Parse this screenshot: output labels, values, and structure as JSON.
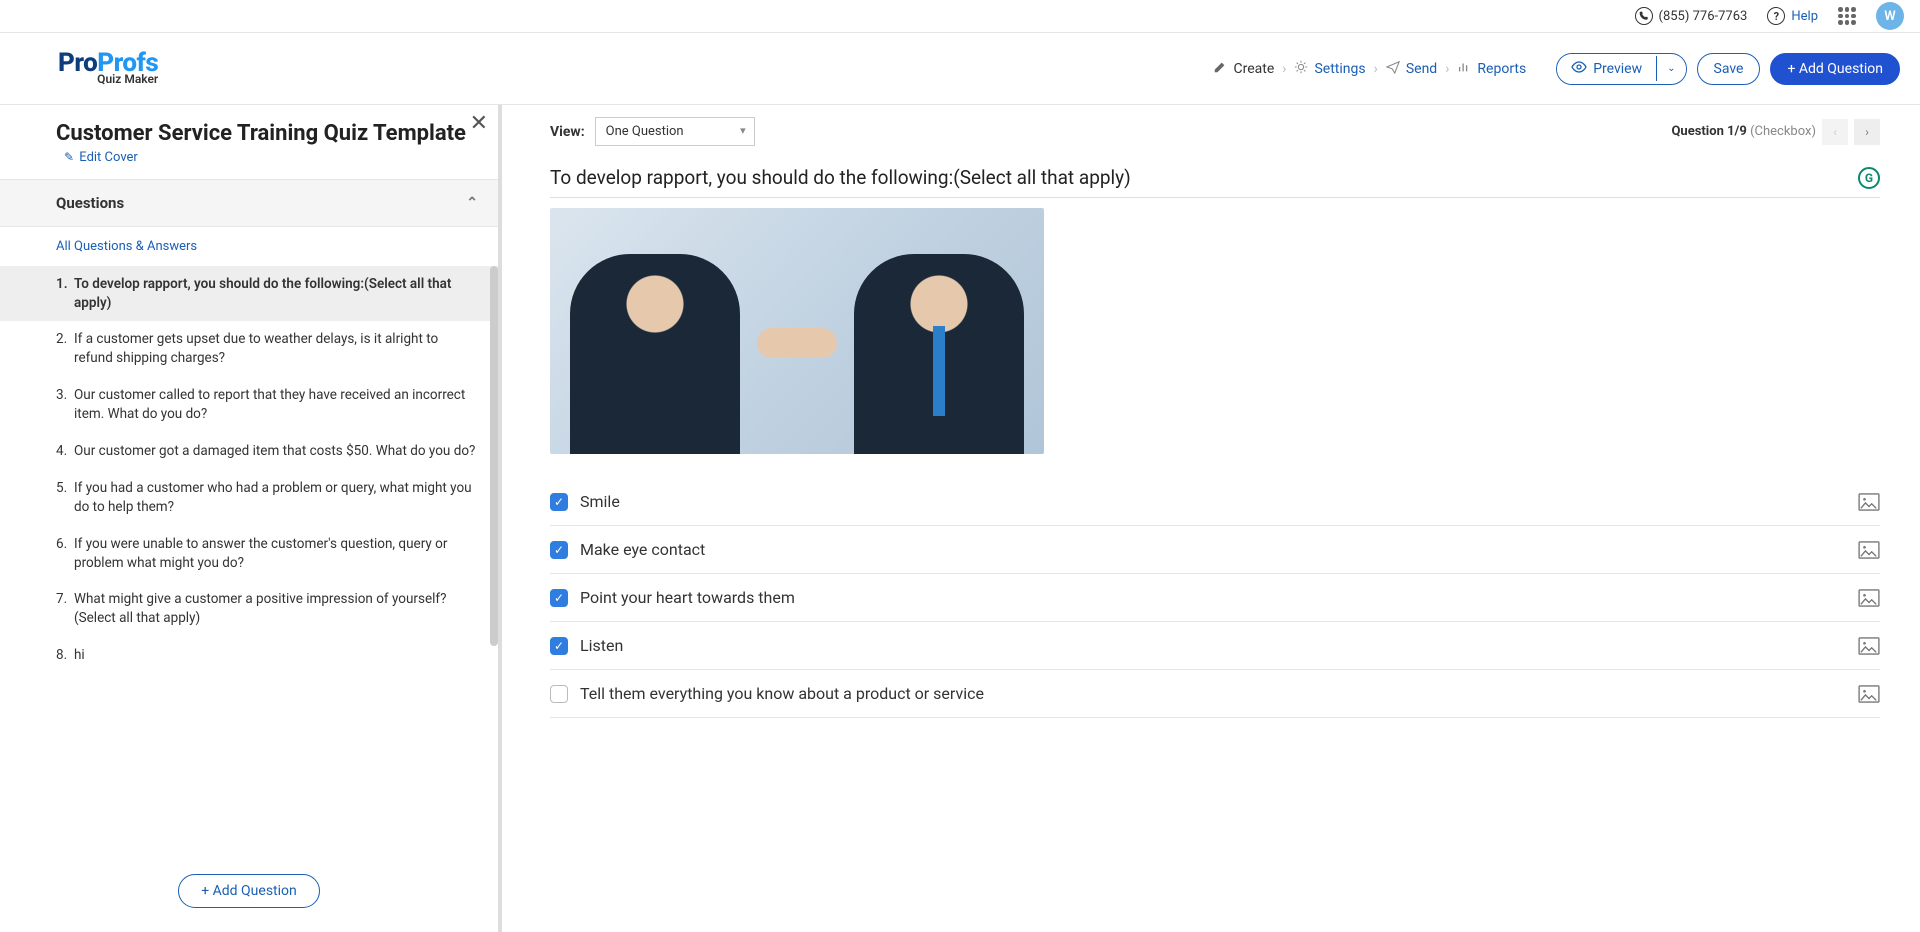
{
  "topbar": {
    "phone": "(855) 776-7763",
    "help": "Help",
    "avatar_initial": "W"
  },
  "logo": {
    "pre": "Pro",
    "post": "Profs",
    "sub": "Quiz Maker"
  },
  "crumbs": {
    "create": "Create",
    "settings": "Settings",
    "send": "Send",
    "reports": "Reports"
  },
  "buttons": {
    "preview": "Preview",
    "save": "Save",
    "add_question": "+ Add Question",
    "sidebar_add_question": "+ Add Question"
  },
  "sidebar": {
    "quiz_title": "Customer Service Training Quiz Template",
    "edit_cover": "Edit Cover",
    "questions_header": "Questions",
    "all_qa": "All Questions & Answers",
    "items": [
      {
        "n": "1.",
        "t": "To develop rapport, you should do the following:(Select all that apply)",
        "active": true
      },
      {
        "n": "2.",
        "t": "If a customer gets upset due to weather delays, is it alright to refund shipping charges?",
        "active": false
      },
      {
        "n": "3.",
        "t": "Our customer called to report that they have received an incorrect item. What do you do?",
        "active": false
      },
      {
        "n": "4.",
        "t": "Our customer got a damaged item that costs $50. What do you do?",
        "active": false
      },
      {
        "n": "5.",
        "t": "If you had a customer who had a problem or query, what might you do to help them?",
        "active": false
      },
      {
        "n": "6.",
        "t": "If you were unable to answer the customer's question, query or problem what might you do?",
        "active": false
      },
      {
        "n": "7.",
        "t": "What might give a customer a positive impression of yourself? (Select all that apply)",
        "active": false
      },
      {
        "n": "8.",
        "t": "hi",
        "active": false
      }
    ]
  },
  "main": {
    "view_label": "View:",
    "view_value": "One Question",
    "qnav_label": "Question 1/9",
    "qnav_type": "(Checkbox)",
    "question_text": "To develop rapport, you should do the following:(Select all that apply)",
    "g_label": "G",
    "options": [
      {
        "text": "Smile",
        "checked": true
      },
      {
        "text": "Make eye contact",
        "checked": true
      },
      {
        "text": "Point your heart towards them",
        "checked": true
      },
      {
        "text": "Listen",
        "checked": true
      },
      {
        "text": "Tell them everything you know about a product or service",
        "checked": false
      }
    ]
  }
}
